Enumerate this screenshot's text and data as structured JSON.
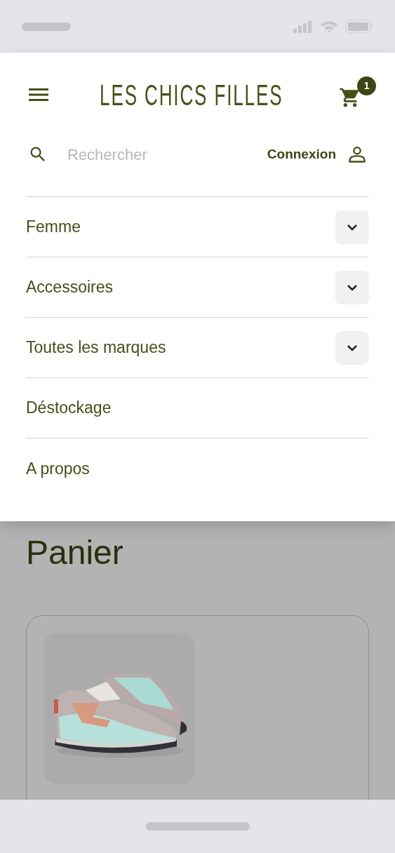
{
  "header": {
    "logo": "LES CHICS FILLES",
    "cart_count": "1"
  },
  "search": {
    "placeholder": "Rechercher"
  },
  "account": {
    "label": "Connexion"
  },
  "menu": [
    {
      "label": "Femme",
      "expandable": true
    },
    {
      "label": "Accessoires",
      "expandable": true
    },
    {
      "label": "Toutes les marques",
      "expandable": true
    },
    {
      "label": "Déstockage",
      "expandable": false
    },
    {
      "label": "A propos",
      "expandable": false
    }
  ],
  "page": {
    "title": "Panier"
  }
}
